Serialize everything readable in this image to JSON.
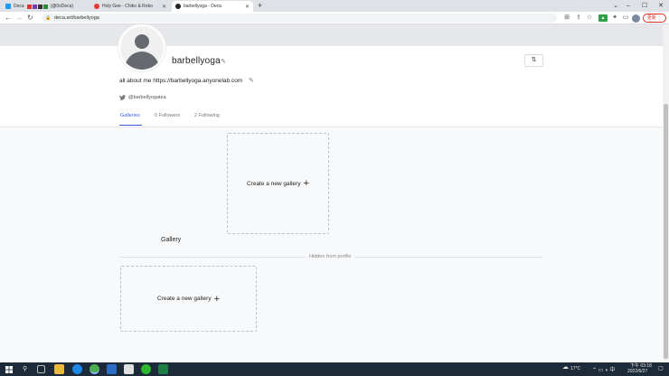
{
  "browser": {
    "tabs": [
      {
        "label": "Deca"
      },
      {
        "label": "(@0xDeca)"
      },
      {
        "label": "Holy Gee - Chiko & Roko"
      },
      {
        "label": "barbellyoga - Deca"
      }
    ],
    "new_tab": "+",
    "window_controls": {
      "minimize": "–",
      "maximize": "☐",
      "close": "✕",
      "tab_search": "⌄"
    },
    "address": "deca.art/barbellyoga",
    "nav": {
      "back": "←",
      "forward": "→",
      "reload": "↻"
    },
    "update_label": "更新 ⋮"
  },
  "profile": {
    "username": "barbellyoga",
    "bio": "all about me https://barbellyoga.anyonelab.com",
    "twitter_handle": "@barbellyogatea",
    "sort_icon": "⇅",
    "edit_icon": "✎",
    "tabs": [
      {
        "label": "Galleries",
        "active": true
      },
      {
        "label": "0 Followers",
        "active": false
      },
      {
        "label": "2 Following",
        "active": false
      }
    ]
  },
  "galleries": {
    "create_label_1": "Create a new gallery",
    "create_label_2": "Create a new gallery",
    "plus": "+",
    "gallery_title": "Gallery",
    "hidden_label": "Hidden from profile"
  },
  "taskbar": {
    "weather": "17°C",
    "time": "下午 03:18",
    "date": "2022/6/27"
  },
  "colors": {
    "accent": "#3b5bdb",
    "twitter": "#1d9bf0",
    "update": "#d93025",
    "taskbar": "#1c2a39"
  }
}
